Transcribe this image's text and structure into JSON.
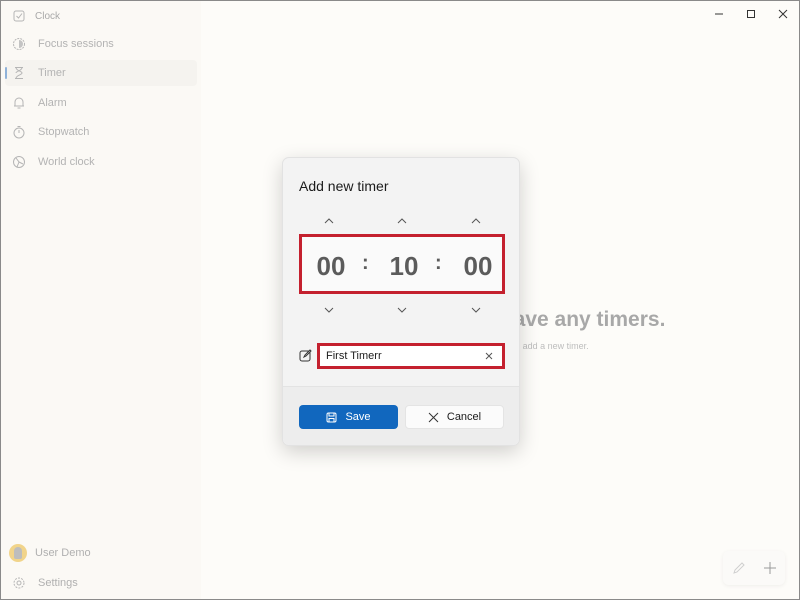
{
  "window": {
    "app_title": "Clock",
    "controls": {
      "minimize": "minimize-icon",
      "maximize": "maximize-icon",
      "close": "close-icon"
    }
  },
  "sidebar": {
    "items": [
      {
        "label": "Focus sessions",
        "icon": "focus-icon",
        "active": false
      },
      {
        "label": "Timer",
        "icon": "hourglass-icon",
        "active": true
      },
      {
        "label": "Alarm",
        "icon": "bell-icon",
        "active": false
      },
      {
        "label": "Stopwatch",
        "icon": "stopwatch-icon",
        "active": false
      },
      {
        "label": "World clock",
        "icon": "globe-icon",
        "active": false
      }
    ],
    "user": {
      "name": "User Demo"
    },
    "settings": {
      "label": "Settings"
    }
  },
  "main": {
    "empty_title": "You don't have any timers.",
    "empty_subtitle": "Select + to add a new timer."
  },
  "fab": {
    "edit": "pencil-icon",
    "add": "plus-icon"
  },
  "dialog": {
    "title": "Add new timer",
    "hours": "00",
    "minutes": "10",
    "seconds": "00",
    "separator": ":",
    "name_value": "First Timerr",
    "save_label": "Save",
    "cancel_label": "Cancel",
    "highlight_color": "#c4202e",
    "accent_color": "#1167be"
  }
}
